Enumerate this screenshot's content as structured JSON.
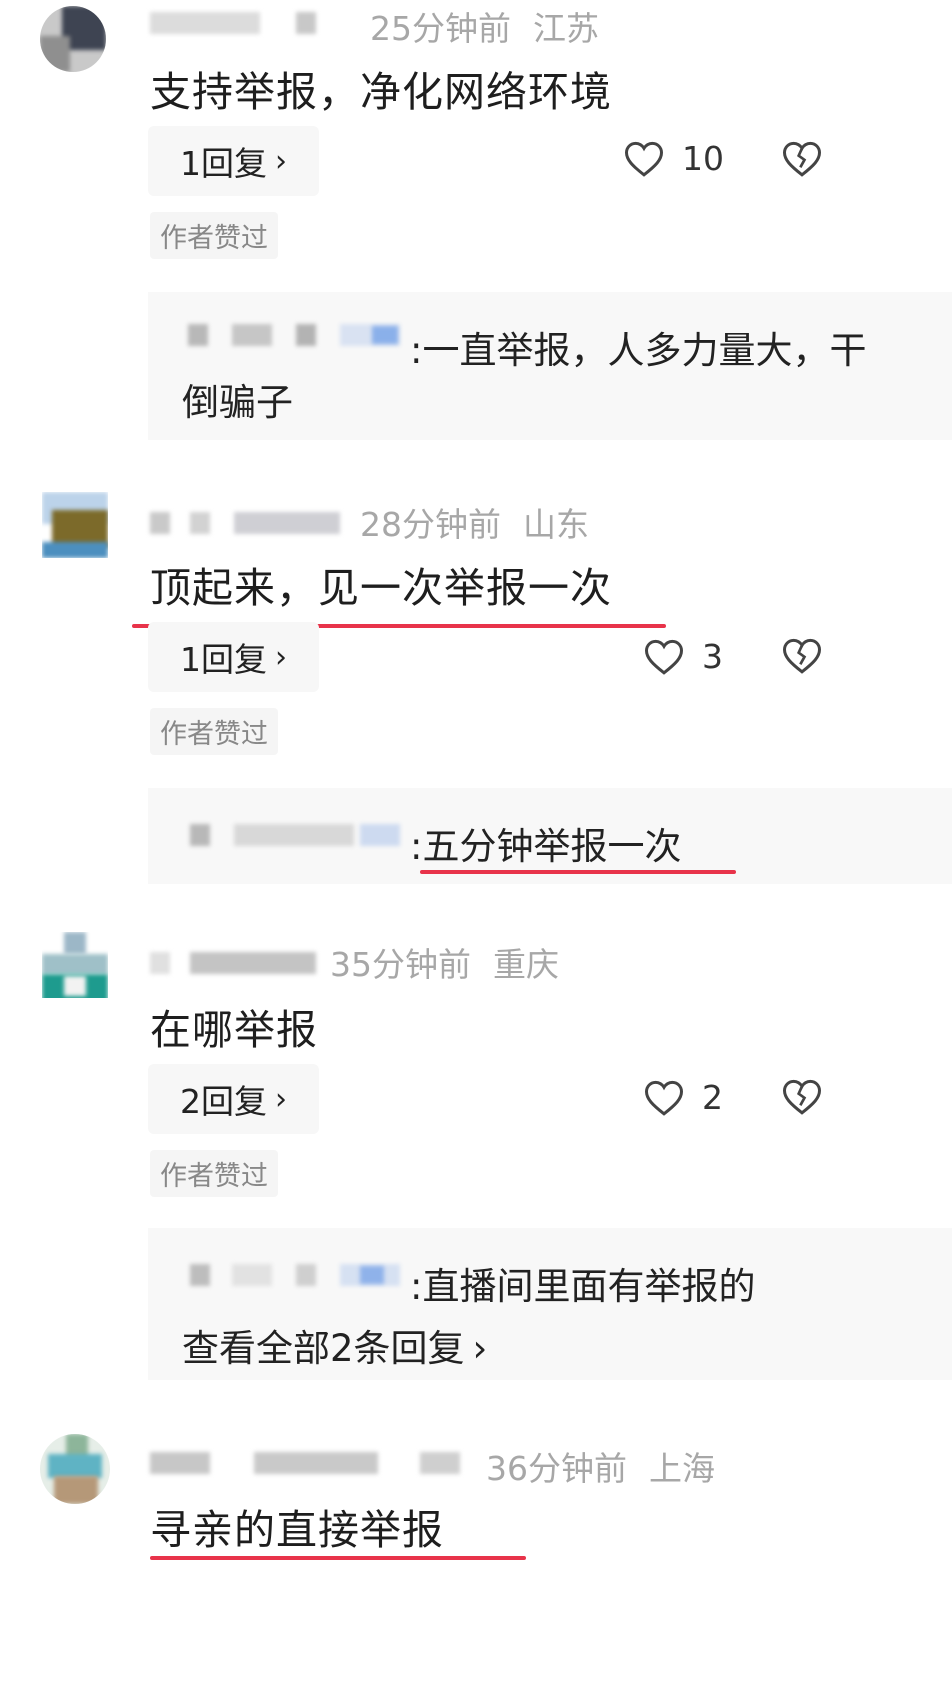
{
  "comments": [
    {
      "time": "25分钟前",
      "location": "江苏",
      "text": "支持举报，净化网络环境",
      "reply_label": "1回复",
      "likes": "10",
      "author_liked": "作者赞过",
      "sub_reply": {
        "text": ":一直举报，人多力量大，干",
        "text_line2": "倒骗子"
      }
    },
    {
      "time": "28分钟前",
      "location": "山东",
      "text": "顶起来，见一次举报一次",
      "reply_label": "1回复",
      "likes": "3",
      "author_liked": "作者赞过",
      "sub_reply": {
        "text": ":五分钟举报一次"
      }
    },
    {
      "time": "35分钟前",
      "location": "重庆",
      "text": "在哪举报",
      "reply_label": "2回复",
      "likes": "2",
      "author_liked": "作者赞过",
      "sub_reply": {
        "text": ":直播间里面有举报的",
        "view_all": "查看全部2条回复"
      }
    },
    {
      "time": "36分钟前",
      "location": "上海",
      "text": "寻亲的直接举报"
    }
  ],
  "accent_underline_color": "#e8334a",
  "icons": {
    "like": "heart-outline-icon",
    "dislike": "broken-heart-icon",
    "chevron": "chevron-right-icon"
  }
}
